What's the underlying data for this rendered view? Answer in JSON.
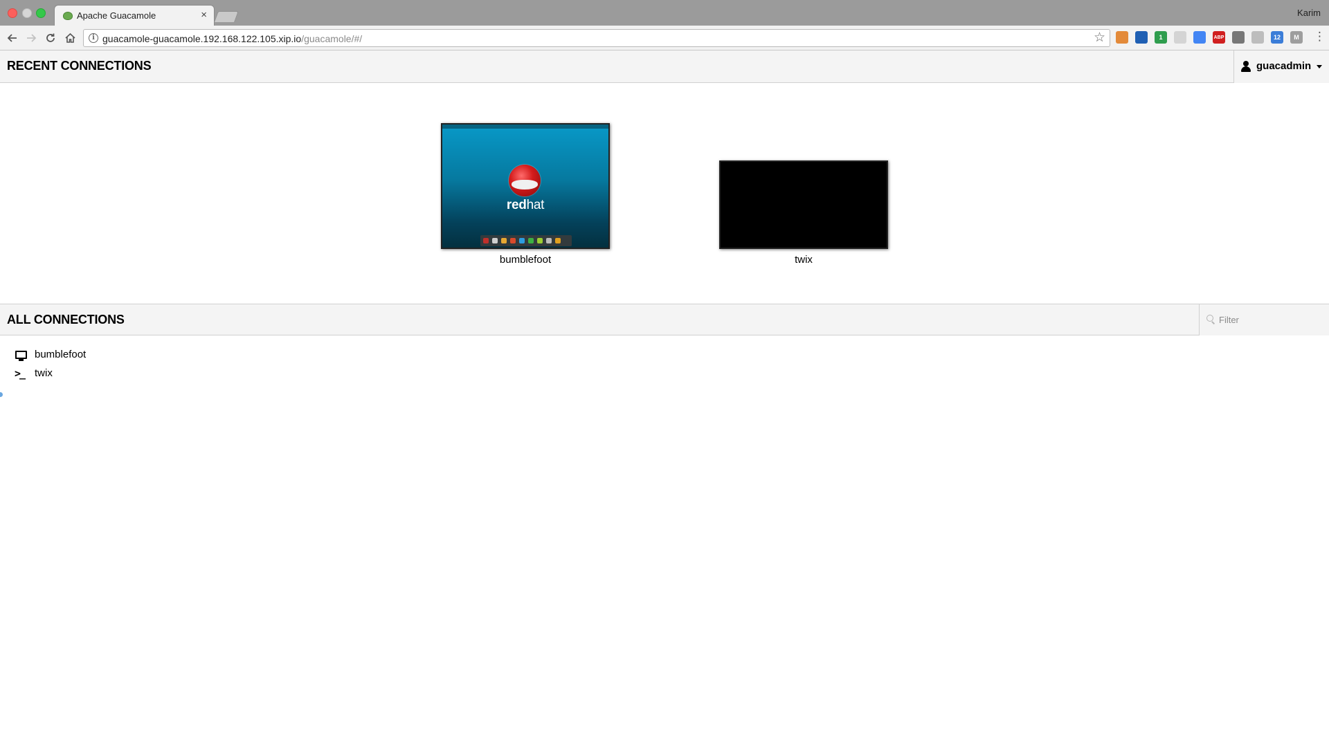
{
  "browser": {
    "tab_title": "Apache Guacamole",
    "tab_close": "×",
    "profile_name": "Karim",
    "url_host": "guacamole-guacamole.192.168.122.105.xip.io",
    "url_path": "/guacamole/#/",
    "nav": {
      "back_icon": "arrow-left-icon",
      "forward_icon": "arrow-right-icon",
      "reload_icon": "reload-icon",
      "home_icon": "home-icon"
    },
    "extensions": [
      {
        "name": "puzzle-icon",
        "color": "#e38a3a",
        "badge": ""
      },
      {
        "name": "bluetooth-like-icon",
        "color": "#1f5fb3",
        "badge": ""
      },
      {
        "name": "hangouts-icon",
        "color": "#2f9d4e",
        "badge": "1"
      },
      {
        "name": "reader-icon",
        "color": "#d4d4d4",
        "badge": ""
      },
      {
        "name": "google-icon",
        "color": "#4285f4",
        "badge": ""
      },
      {
        "name": "adblock-plus-icon",
        "color": "#d01f1f",
        "badge": "ABP"
      },
      {
        "name": "cast-icon",
        "color": "#777777",
        "badge": ""
      },
      {
        "name": "dot-icon",
        "color": "#bdbdbd",
        "badge": ""
      },
      {
        "name": "calendar-icon",
        "color": "#3b7dd8",
        "badge": "12"
      },
      {
        "name": "gmail-icon",
        "color": "#9e9e9e",
        "badge": "M"
      }
    ]
  },
  "recent": {
    "title": "RECENT CONNECTIONS",
    "user": "guacadmin",
    "tiles": [
      {
        "name": "bumblefoot",
        "kind": "desktop",
        "thumb_text_bold": "red",
        "thumb_text": "hat"
      },
      {
        "name": "twix",
        "kind": "terminal"
      }
    ]
  },
  "all": {
    "title": "ALL CONNECTIONS",
    "filter_placeholder": "Filter",
    "items": [
      {
        "name": "bumblefoot",
        "icon": "monitor-icon"
      },
      {
        "name": "twix",
        "icon": "terminal-icon",
        "glyph": ">_"
      }
    ]
  },
  "colors": {
    "header_bg": "#f4f4f4",
    "desktop_top": "#0899c8",
    "desktop_bottom": "#03303f"
  }
}
